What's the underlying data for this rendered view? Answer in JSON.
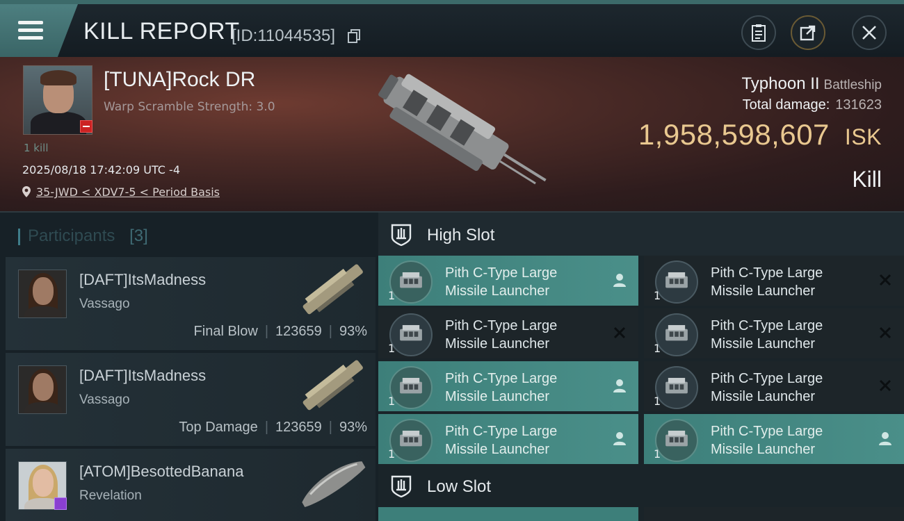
{
  "topbar": {
    "title": "KILL REPORT",
    "kill_id": "[ID:11044535]"
  },
  "victim": {
    "name": "[TUNA]Rock DR",
    "warp_scramble": "Warp Scramble Strength: 3.0",
    "kills": "1 kill",
    "datetime": "2025/08/18 17:42:09 UTC -4",
    "location": "35-JWD < XDV7-5 < Period Basis",
    "ship": "Typhoon II",
    "ship_class": "Battleship",
    "total_damage_label": "Total damage:",
    "total_damage": "131623",
    "isk_value": "1,958,598,607",
    "isk_unit": "ISK",
    "type": "Kill"
  },
  "participants": {
    "label": "Participants",
    "count": "[3]",
    "rows": [
      {
        "name": "[DAFT]ItsMadness",
        "ship": "Vassago",
        "role": "Final Blow",
        "damage": "123659",
        "percent": "93%"
      },
      {
        "name": "[DAFT]ItsMadness",
        "ship": "Vassago",
        "role": "Top Damage",
        "damage": "123659",
        "percent": "93%"
      },
      {
        "name": "[ATOM]BesottedBanana",
        "ship": "Revelation",
        "role": "",
        "damage": "",
        "percent": ""
      }
    ]
  },
  "high_slot": {
    "label": "High Slot",
    "modules": [
      {
        "line1": "Pith C-Type Large",
        "line2": "Missile Launcher",
        "qty": "1",
        "state": "fitted",
        "status_icon": "pilot-icon"
      },
      {
        "line1": "Pith C-Type Large",
        "line2": "Missile Launcher",
        "qty": "1",
        "state": "empty",
        "status_icon": "destroyed-icon"
      },
      {
        "line1": "Pith C-Type Large",
        "line2": "Missile Launcher",
        "qty": "1",
        "state": "empty",
        "status_icon": "destroyed-icon"
      },
      {
        "line1": "Pith C-Type Large",
        "line2": "Missile Launcher",
        "qty": "1",
        "state": "empty",
        "status_icon": "destroyed-icon"
      },
      {
        "line1": "Pith C-Type Large",
        "line2": "Missile Launcher",
        "qty": "1",
        "state": "fitted",
        "status_icon": "pilot-icon"
      },
      {
        "line1": "Pith C-Type Large",
        "line2": "Missile Launcher",
        "qty": "1",
        "state": "empty",
        "status_icon": "destroyed-icon"
      },
      {
        "line1": "Pith C-Type Large",
        "line2": "Missile Launcher",
        "qty": "1",
        "state": "fitted",
        "status_icon": "pilot-icon"
      },
      {
        "line1": "Pith C-Type Large",
        "line2": "Missile Launcher",
        "qty": "1",
        "state": "fitted",
        "status_icon": "pilot-icon"
      }
    ]
  },
  "low_slot": {
    "label": "Low Slot"
  },
  "colors": {
    "accent": "#3f7d8a",
    "fitted_module": "#4a8f89",
    "isk_gold": "#e9c890",
    "menu_tab": "#4d7f80"
  }
}
